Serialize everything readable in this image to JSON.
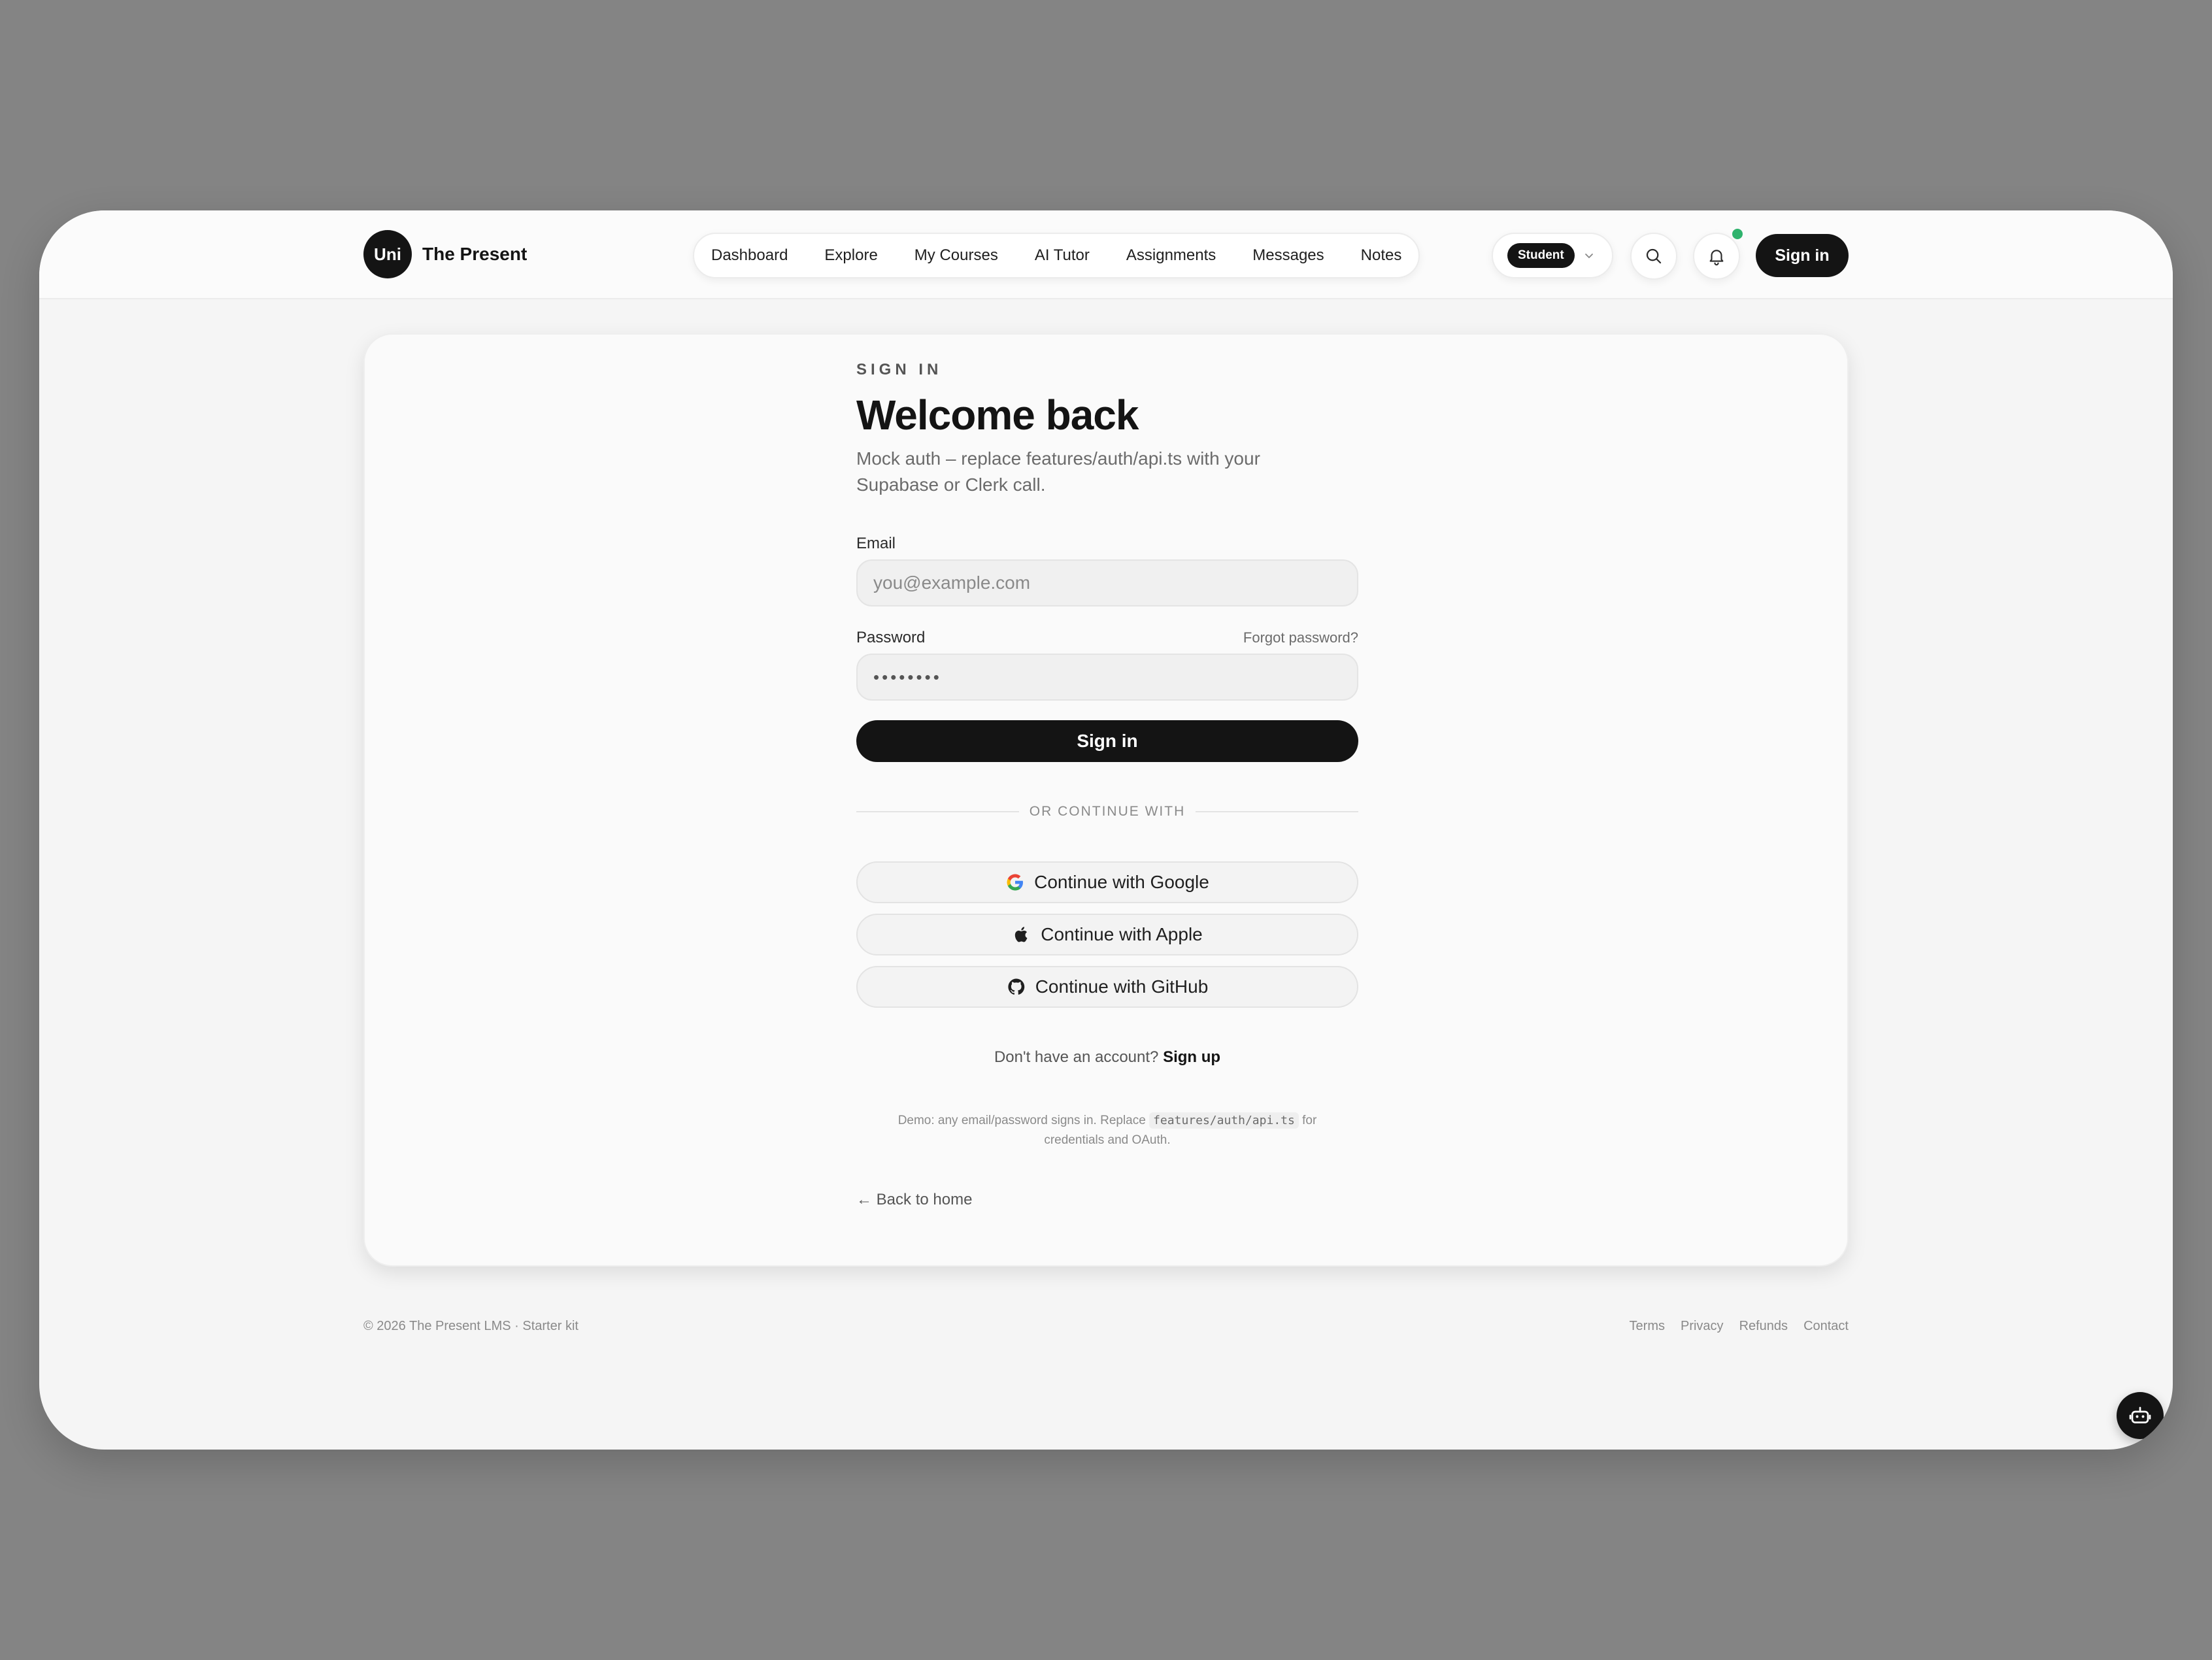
{
  "brand": {
    "badge": "Uni",
    "name": "The Present"
  },
  "nav": {
    "items": [
      {
        "label": "Dashboard"
      },
      {
        "label": "Explore"
      },
      {
        "label": "My Courses"
      },
      {
        "label": "AI Tutor"
      },
      {
        "label": "Assignments"
      },
      {
        "label": "Messages"
      },
      {
        "label": "Notes"
      }
    ]
  },
  "header": {
    "role": "Student",
    "signin_label": "Sign in",
    "icons": {
      "search": "search-icon",
      "bell": "bell-icon",
      "role_chevron": "chevron-down-icon"
    }
  },
  "form": {
    "eyebrow": "SIGN IN",
    "title": "Welcome back",
    "subtitle": "Mock auth – replace features/auth/api.ts with your Supabase or Clerk call.",
    "email_label": "Email",
    "email_placeholder": "you@example.com",
    "password_label": "Password",
    "forgot_label": "Forgot password?",
    "password_value": "••••••••",
    "submit_label": "Sign in",
    "divider_label": "OR CONTINUE WITH",
    "socials": [
      {
        "label": "Continue with Google",
        "icon": "google-icon"
      },
      {
        "label": "Continue with Apple",
        "icon": "apple-icon"
      },
      {
        "label": "Continue with GitHub",
        "icon": "github-icon"
      }
    ],
    "signup_prompt": "Don't have an account?",
    "signup_link": "Sign up",
    "demo_prefix": "Demo: any email/password signs in. Replace",
    "demo_code": "features/auth/api.ts",
    "demo_suffix": "for credentials and OAuth.",
    "back_label": "← Back to home"
  },
  "footer": {
    "copyright": "© 2026 The Present LMS · Starter kit",
    "links": [
      "Terms",
      "Privacy",
      "Refunds",
      "Contact"
    ]
  },
  "colors": {
    "accent": "#141414",
    "notification": "#2fb36d",
    "background": "#f5f5f5"
  }
}
